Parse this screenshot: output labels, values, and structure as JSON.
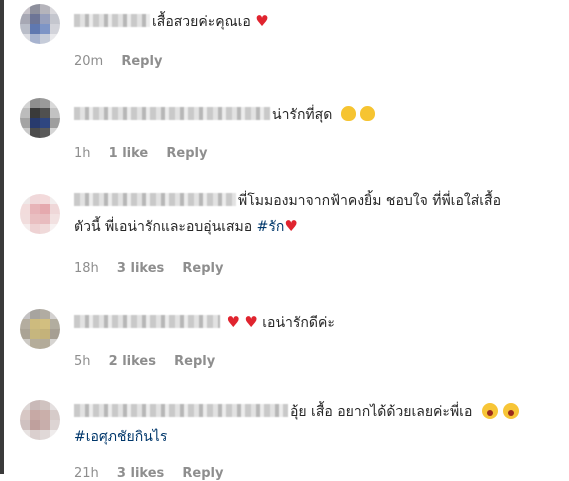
{
  "comments": [
    {
      "text": "เสื้อสวยค่ะคุณเอ",
      "time": "20m",
      "reply": "Reply"
    },
    {
      "text": "น่ารักที่สุด",
      "time": "1h",
      "likes": "1 like",
      "reply": "Reply"
    },
    {
      "line1": "พี่โมมองมาจากฟ้าคงยิ้ม ชอบใจ ที่พี่เอใส่เสื้อ",
      "line2": "ตัวนี้ พี่เอน่ารักและอบอุ่นเสมอ",
      "hashtag": "#รัก",
      "time": "18h",
      "likes": "3 likes",
      "reply": "Reply"
    },
    {
      "text": "เอน่ารักดีค่ะ",
      "time": "5h",
      "likes": "2 likes",
      "reply": "Reply"
    },
    {
      "text": "อุ้ย เสื้อ อยากได้ด้วยเลยค่ะพี่เอ",
      "hashtag": "#เอศุภชัยกินไร",
      "time": "21h",
      "likes": "3 likes",
      "reply": "Reply"
    }
  ],
  "icons": {
    "heart": "heart-icon",
    "clap": "clapping-hands-icon",
    "wow": "astonished-face-icon"
  },
  "colors": {
    "heart": "#e0242f",
    "hashtag": "#00376b",
    "meta": "#8e8e8e"
  }
}
